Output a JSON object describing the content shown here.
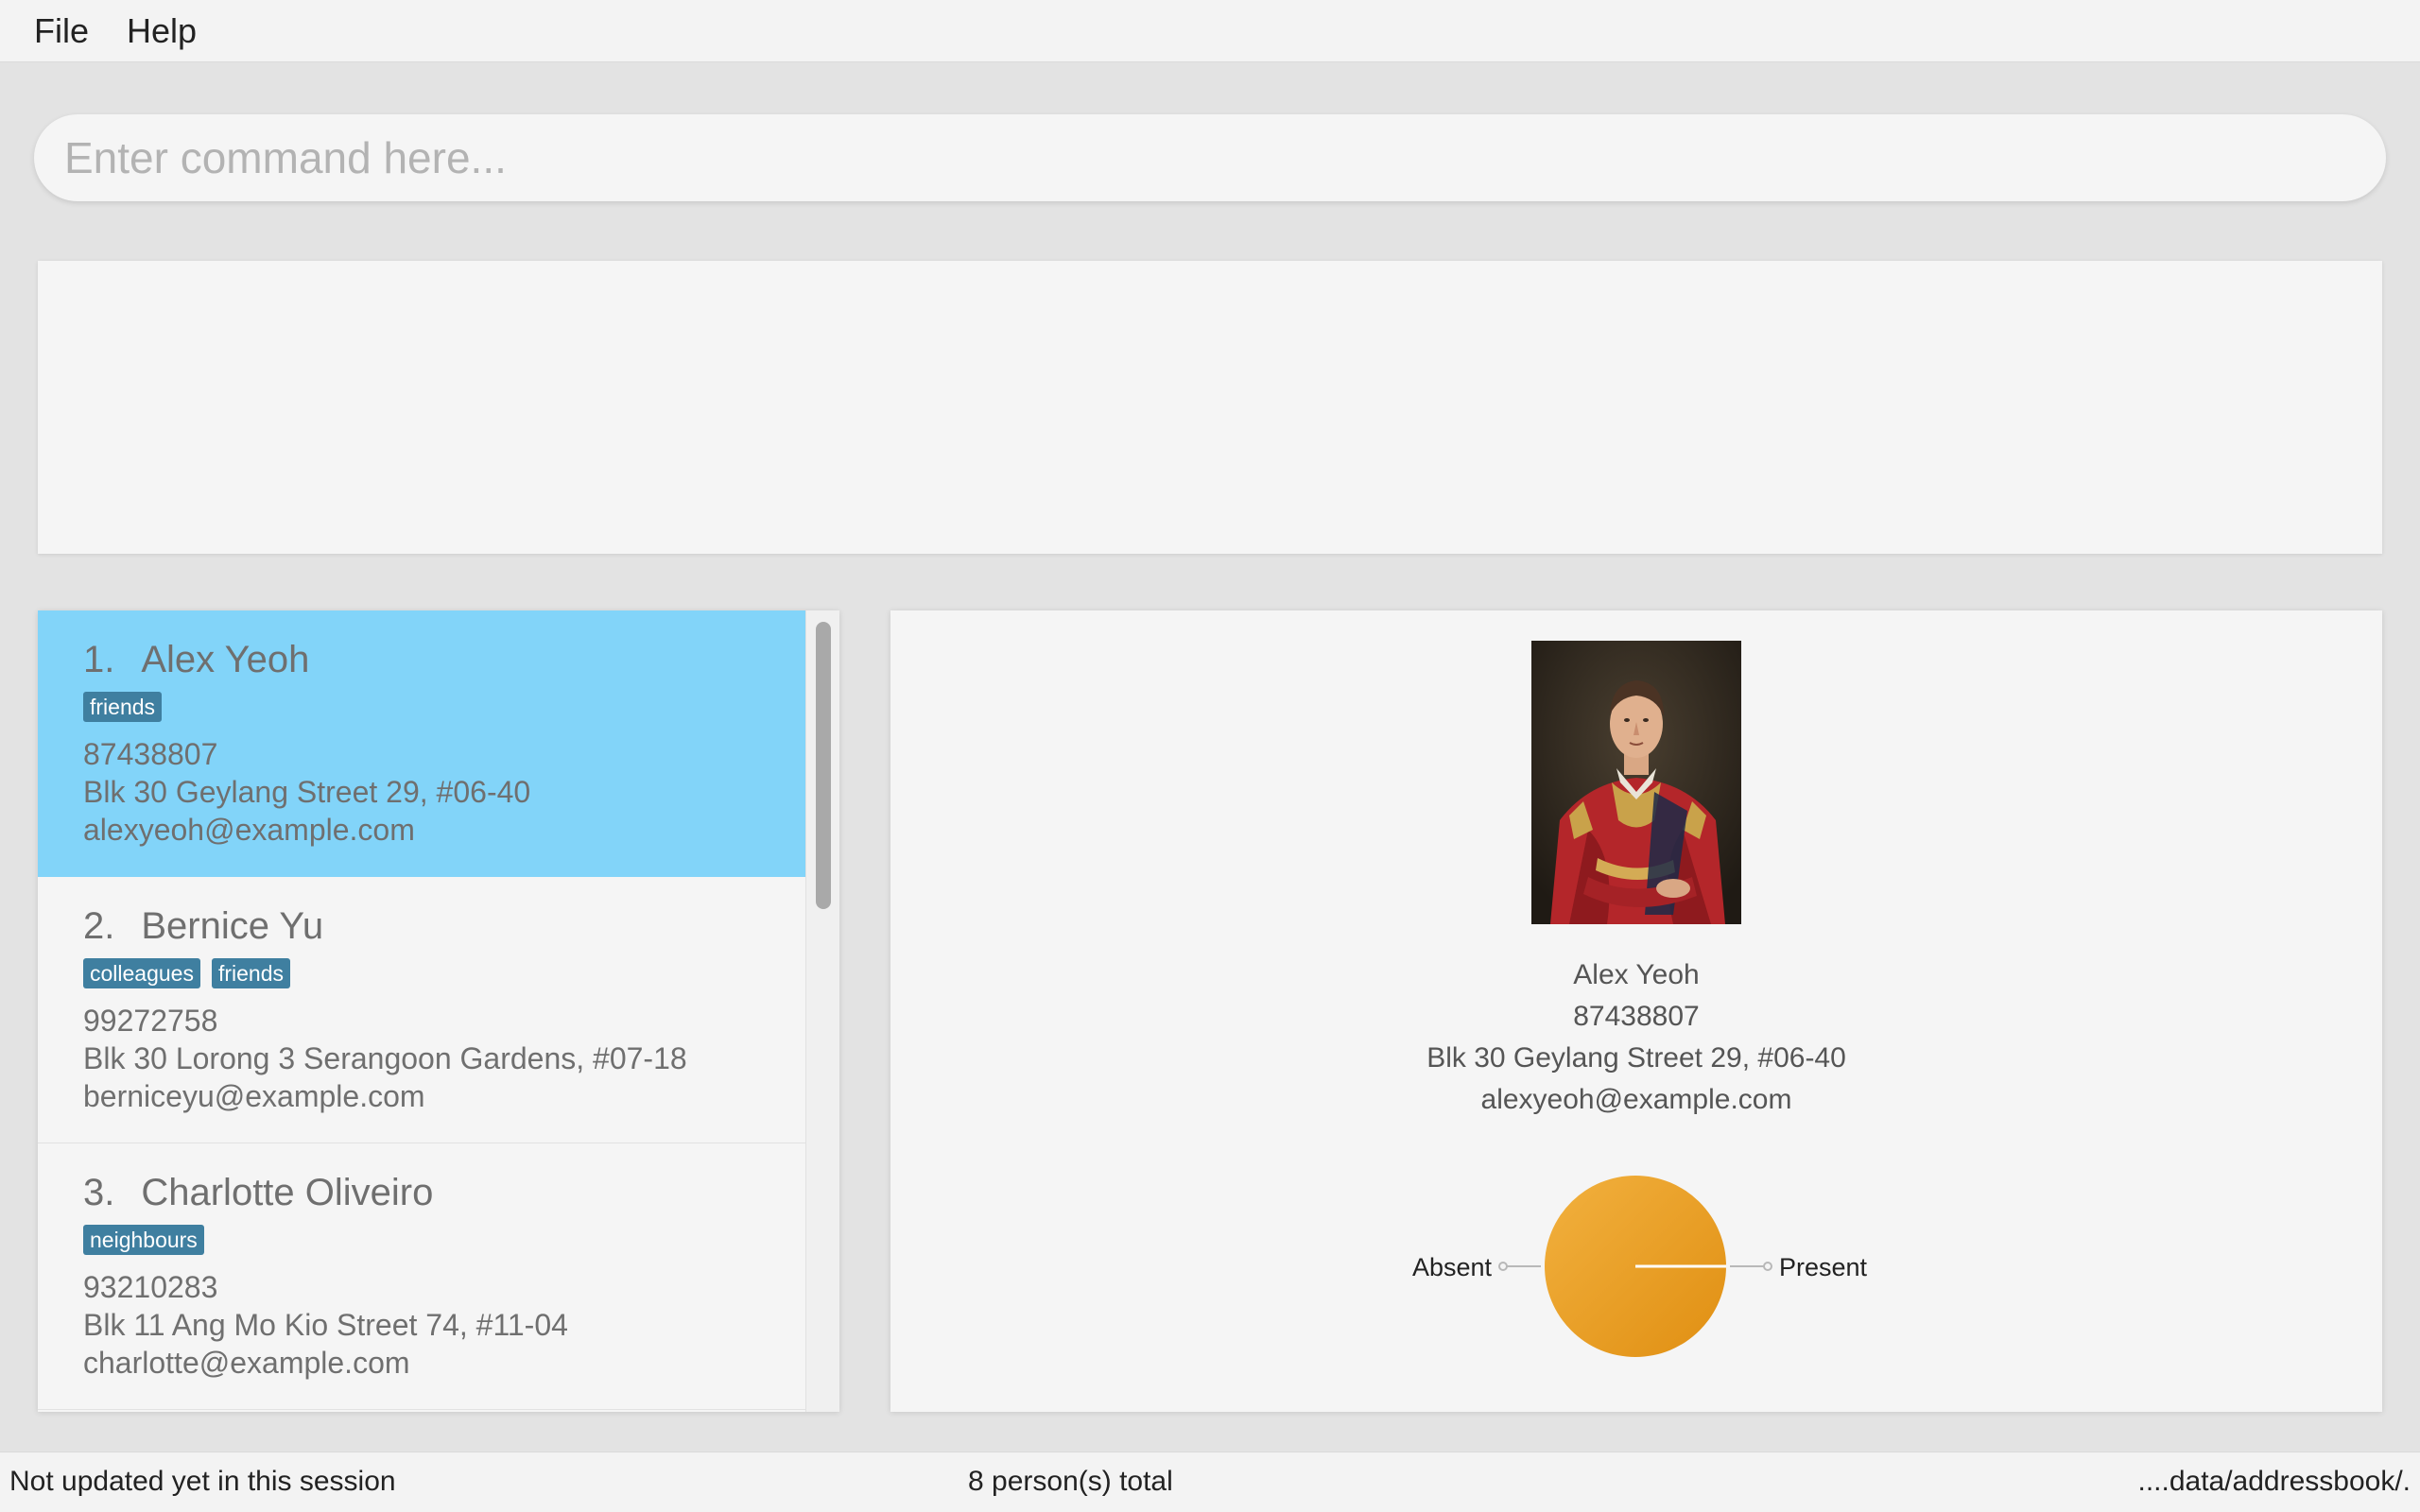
{
  "menu": {
    "file_label": "File",
    "help_label": "Help"
  },
  "command": {
    "placeholder": "Enter command here...",
    "value": ""
  },
  "result_display": {
    "text": ""
  },
  "persons": [
    {
      "index": "1.",
      "name": "Alex Yeoh",
      "tags": [
        "friends"
      ],
      "phone": "87438807",
      "address": "Blk 30 Geylang Street 29, #06-40",
      "email": "alexyeoh@example.com",
      "selected": true
    },
    {
      "index": "2.",
      "name": "Bernice Yu",
      "tags": [
        "colleagues",
        "friends"
      ],
      "phone": "99272758",
      "address": "Blk 30 Lorong 3 Serangoon Gardens, #07-18",
      "email": "berniceyu@example.com",
      "selected": false
    },
    {
      "index": "3.",
      "name": "Charlotte Oliveiro",
      "tags": [
        "neighbours"
      ],
      "phone": "93210283",
      "address": "Blk 11 Ang Mo Kio Street 74, #11-04",
      "email": "charlotte@example.com",
      "selected": false
    }
  ],
  "detail": {
    "name": "Alex Yeoh",
    "phone": "87438807",
    "address": "Blk 30 Geylang Street 29, #06-40",
    "email": "alexyeoh@example.com"
  },
  "chart_data": {
    "type": "pie",
    "categories": [
      "Absent",
      "Present"
    ],
    "values": [
      0,
      100
    ],
    "colors": [
      "#e8a93a",
      "#e8a93a"
    ]
  },
  "status": {
    "sync": "Not updated yet in this session",
    "total": "8 person(s) total",
    "path": "....data/addressbook/."
  },
  "colors": {
    "selected_card": "#82d4f9",
    "tag": "#3f7fa0",
    "pie_fill": "#e8a93a"
  }
}
